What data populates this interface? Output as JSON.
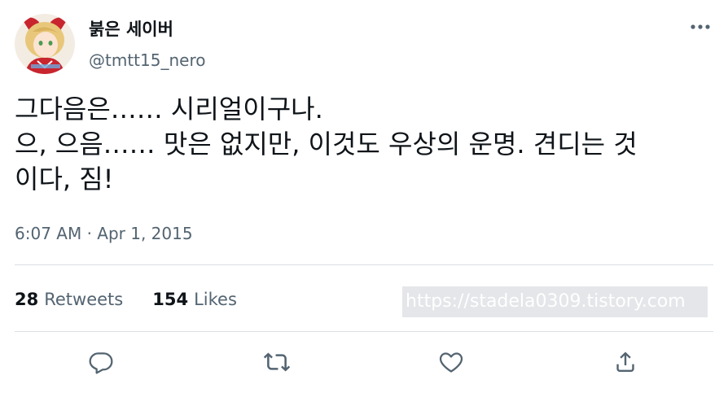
{
  "author": {
    "display_name": "붉은 세이버",
    "handle": "@tmtt15_nero",
    "avatar_icon": "avatar-image"
  },
  "header": {
    "more_icon": "more-options-icon"
  },
  "tweet": {
    "lines": [
      "그다음은…… 시리얼이구나.",
      "으, 으음…… 맛은 없지만, 이것도 우상의 운명. 견디는 것",
      "이다, 짐!"
    ],
    "timestamp": "6:07 AM · Apr 1, 2015"
  },
  "stats": {
    "retweets_count": "28",
    "retweets_label": "Retweets",
    "likes_count": "154",
    "likes_label": "Likes"
  },
  "watermark": {
    "text": "https://stadela0309.tistory.com"
  },
  "actions": [
    {
      "name": "reply",
      "icon": "reply-icon"
    },
    {
      "name": "retweet",
      "icon": "retweet-icon"
    },
    {
      "name": "like",
      "icon": "heart-icon"
    },
    {
      "name": "share",
      "icon": "share-icon"
    }
  ],
  "colors": {
    "text_primary": "#0f1419",
    "text_secondary": "#536471",
    "divider": "#dadfe3",
    "action_icon": "#536471"
  }
}
